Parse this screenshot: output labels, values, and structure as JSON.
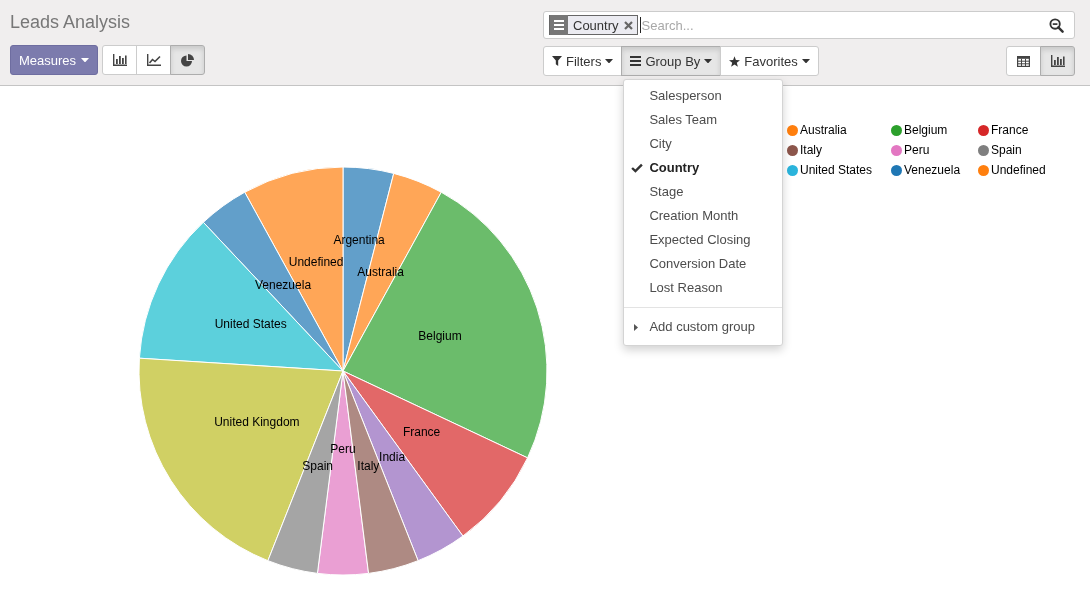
{
  "title": "Leads Analysis",
  "measures_button": {
    "label": "Measures"
  },
  "chart_modes": [
    {
      "kind": "bar",
      "selected": false
    },
    {
      "kind": "line",
      "selected": false
    },
    {
      "kind": "pie",
      "selected": true
    }
  ],
  "search": {
    "facets": [
      {
        "label": "Country"
      }
    ],
    "placeholder": "Search..."
  },
  "search_buttons": [
    {
      "kind": "filter",
      "label": "Filters",
      "expanded": false
    },
    {
      "kind": "group",
      "label": "Group By",
      "expanded": true
    },
    {
      "kind": "favorite",
      "label": "Favorites",
      "expanded": false
    }
  ],
  "views": [
    {
      "kind": "table",
      "selected": false
    },
    {
      "kind": "graph",
      "selected": true
    }
  ],
  "group_by_menu": {
    "items": [
      {
        "label": "Salesperson",
        "checked": false
      },
      {
        "label": "Sales Team",
        "checked": false
      },
      {
        "label": "City",
        "checked": false
      },
      {
        "label": "Country",
        "checked": true
      },
      {
        "label": "Stage",
        "checked": false
      },
      {
        "label": "Creation Month",
        "checked": false
      },
      {
        "label": "Expected Closing",
        "checked": false
      },
      {
        "label": "Conversion Date",
        "checked": false
      },
      {
        "label": "Lost Reason",
        "checked": false
      }
    ],
    "custom_group": "Add custom group"
  },
  "chart": {
    "slices": [
      {
        "label": "Argentina",
        "color": "#629fca"
      },
      {
        "label": "Undefined",
        "color": "#ffa657"
      },
      {
        "label": "Australia",
        "color": "#ffa657"
      },
      {
        "label": "Venezuela",
        "color": "#629fca"
      },
      {
        "label": "United States",
        "color": "#5cd0dc"
      },
      {
        "label": "Belgium",
        "color": "#6bbc6b"
      },
      {
        "label": "United Kingdom",
        "color": "#d0d064"
      },
      {
        "label": "France",
        "color": "#e26868"
      },
      {
        "label": "Peru",
        "color": "#ea9fd3"
      },
      {
        "label": "India",
        "color": "#b395d0"
      },
      {
        "label": "Spain",
        "color": "#a5a5a5"
      },
      {
        "label": "Italy",
        "color": "#ae8a83"
      }
    ],
    "legend": [
      {
        "label": "Australia",
        "color": "#ff7f0e"
      },
      {
        "label": "Belgium",
        "color": "#2ca02c"
      },
      {
        "label": "France",
        "color": "#d62728"
      },
      {
        "label": "Italy",
        "color": "#8c564b"
      },
      {
        "label": "Peru",
        "color": "#e377c2"
      },
      {
        "label": "Spain",
        "color": "#7f7f7f"
      },
      {
        "label": "United States",
        "color": "#2ab4dc"
      },
      {
        "label": "Venezuela",
        "color": "#1f77b4"
      },
      {
        "label": "Undefined",
        "color": "#ff7f0e"
      }
    ]
  }
}
